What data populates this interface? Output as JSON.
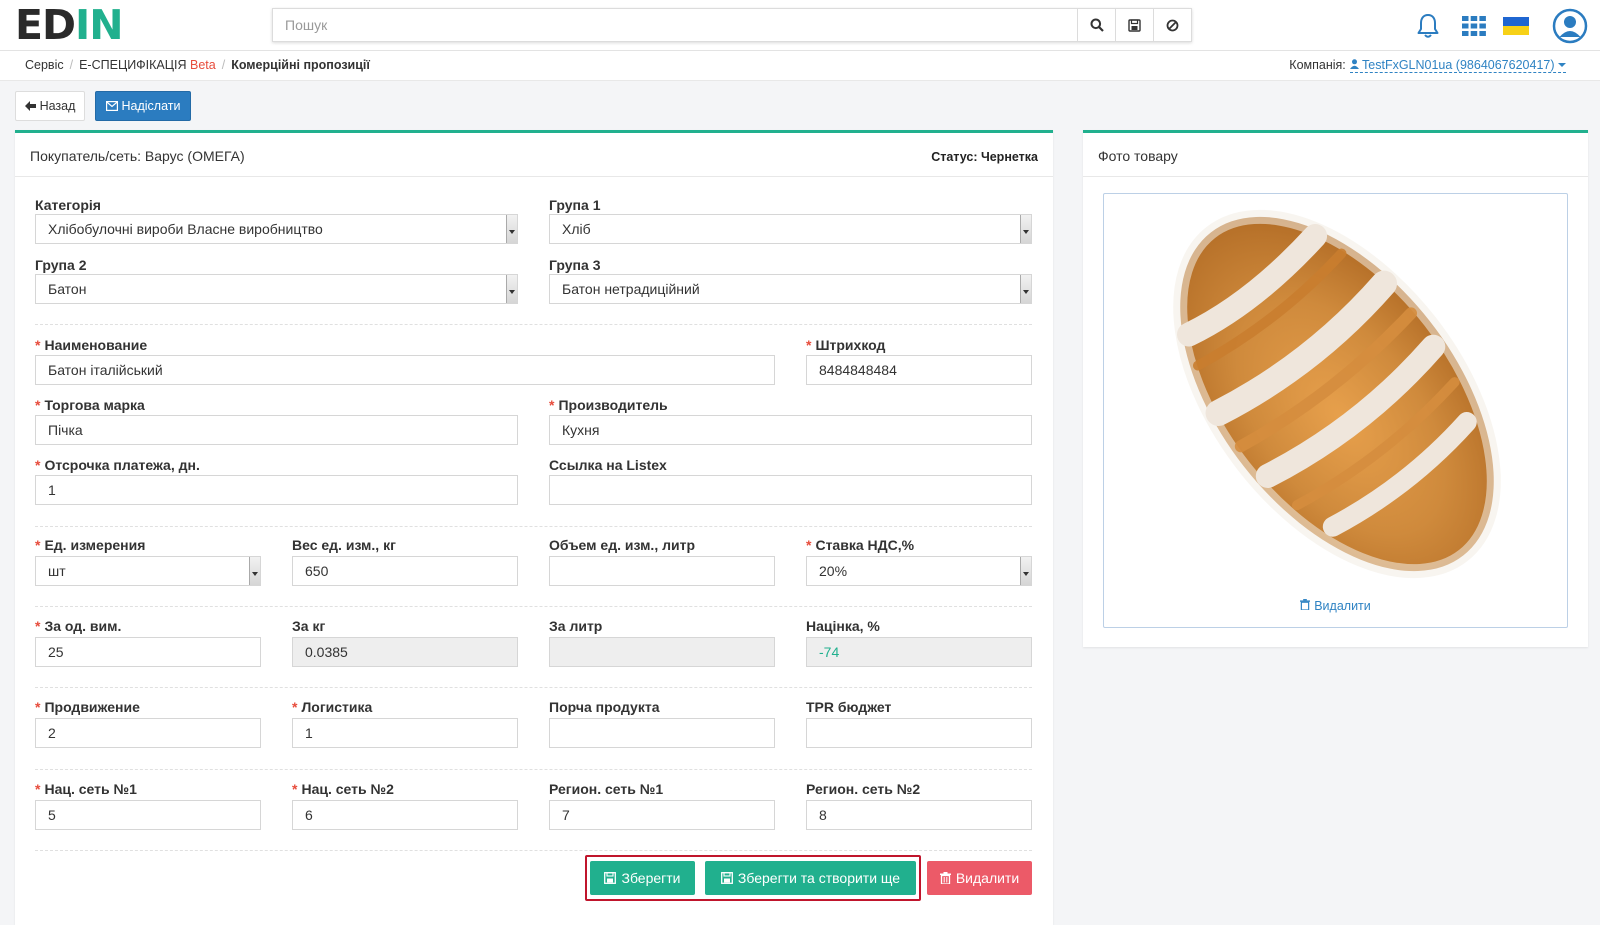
{
  "header": {
    "logo_main": "ED",
    "logo_accent": "IN",
    "search_placeholder": "Пошук",
    "icons": [
      "search-icon",
      "save-icon",
      "reset-icon",
      "bell-icon",
      "apps-grid-icon",
      "ukraine-flag-icon",
      "user-avatar-icon"
    ]
  },
  "breadcrumb": {
    "items": [
      "Сервіс",
      "Е-СПЕЦИФІКАЦІЯ",
      "Комерційні пропозиції"
    ],
    "beta": "Beta",
    "company_label": "Компанія:",
    "company_value": "TestFxGLN01ua (9864067620417)"
  },
  "toolbar": {
    "back_label": "Назад",
    "send_label": "Надіслати"
  },
  "form": {
    "title": "Покупатель/сеть: Варус (ОМЕГА)",
    "status": "Статус: Чернетка",
    "category": {
      "label": "Категорія",
      "value": "Хлібобулочні вироби Власне виробництво"
    },
    "group1": {
      "label": "Група 1",
      "value": "Хліб"
    },
    "group2": {
      "label": "Група 2",
      "value": "Батон"
    },
    "group3": {
      "label": "Група 3",
      "value": "Батон нетрадиційний"
    },
    "name": {
      "label": "Наименование",
      "value": "Батон італійський"
    },
    "barcode": {
      "label": "Штрихкод",
      "value": "8484848484"
    },
    "brand": {
      "label": "Торгова марка",
      "value": "Пічка"
    },
    "producer": {
      "label": "Производитель",
      "value": "Кухня"
    },
    "delay": {
      "label": "Отсрочка платежа, дн.",
      "value": "1"
    },
    "listex": {
      "label": "Ссылка на Listex",
      "value": ""
    },
    "unit": {
      "label": "Ед. измерения",
      "value": "шт"
    },
    "weight": {
      "label": "Вес ед. изм., кг",
      "value": "650"
    },
    "volume": {
      "label": "Объем ед. изм., литр",
      "value": ""
    },
    "vat": {
      "label": "Ставка НДС,%",
      "value": "20%"
    },
    "per_unit": {
      "label": "За од. вим.",
      "value": "25"
    },
    "per_kg": {
      "label": "За кг",
      "value": "0.0385"
    },
    "per_liter": {
      "label": "За литр",
      "value": ""
    },
    "markup": {
      "label": "Націнка, %",
      "value": "-74"
    },
    "promotion": {
      "label": "Продвижение",
      "value": "2"
    },
    "logistics": {
      "label": "Логистика",
      "value": "1"
    },
    "spoilage": {
      "label": "Порча продукта",
      "value": ""
    },
    "tpr": {
      "label": "TPR бюджет",
      "value": ""
    },
    "nat1": {
      "label": "Нац. сеть №1",
      "value": "5"
    },
    "nat2": {
      "label": "Нац. сеть №2",
      "value": "6"
    },
    "reg1": {
      "label": "Регион. сеть №1",
      "value": "7"
    },
    "reg2": {
      "label": "Регион. сеть №2",
      "value": "8"
    }
  },
  "actions": {
    "save_label": "Зберегти",
    "save_create_label": "Зберегти та створити ще",
    "delete_label": "Видалити"
  },
  "photo": {
    "title": "Фото товару",
    "delete_label": "Видалити"
  },
  "colors": {
    "accent": "#21b08e",
    "primary": "#2b7cc0",
    "danger": "#ec5a68",
    "highlight": "#c0152c"
  }
}
